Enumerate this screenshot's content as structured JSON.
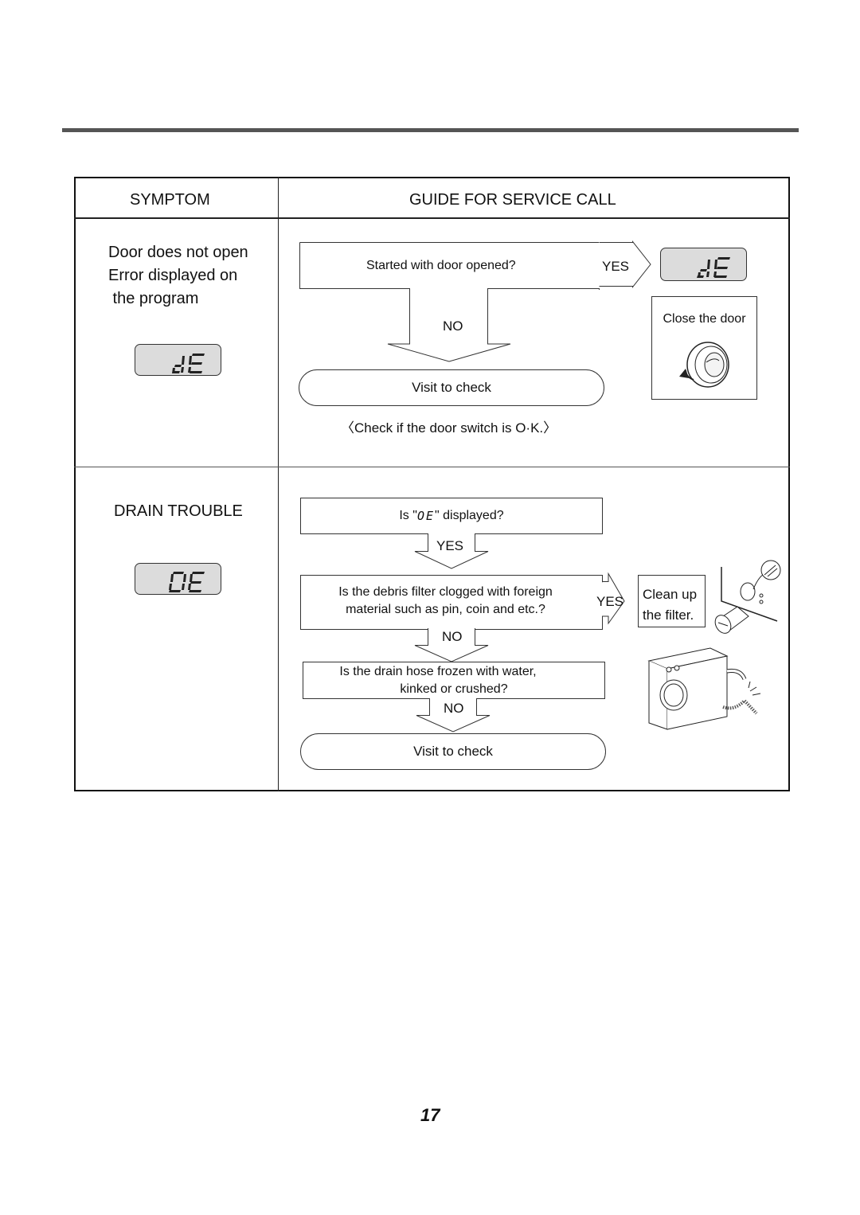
{
  "header": {
    "symptom_label": "SYMPTOM",
    "guide_label": "GUIDE FOR SERVICE CALL"
  },
  "door": {
    "symptom_lines": [
      "Door does not open",
      "Error displayed on",
      " the program"
    ],
    "error_code": "dE",
    "question": "Started with door opened?",
    "yes_label": "YES",
    "no_label": "NO",
    "yes_action": "Close the door",
    "visit": "Visit to check",
    "note": "Check if the door switch is O·K."
  },
  "drain": {
    "symptom": "DRAIN TROUBLE",
    "error_code": "OE",
    "q1_prefix": "Is \"",
    "q1_code": "OE",
    "q1_suffix": "\" displayed?",
    "q1_yes": "YES",
    "q2_line1": "Is the debris filter clogged with foreign",
    "q2_line2": "material such as pin, coin and etc.?",
    "q2_yes": "YES",
    "q2_yes_action_line1": "Clean up",
    "q2_yes_action_line2": "the filter.",
    "q2_no": "NO",
    "q3_line1": "Is the drain hose frozen with water,",
    "q3_line2": "kinked or crushed?",
    "q3_no": "NO",
    "visit": "Visit to check"
  },
  "page_number": "17"
}
